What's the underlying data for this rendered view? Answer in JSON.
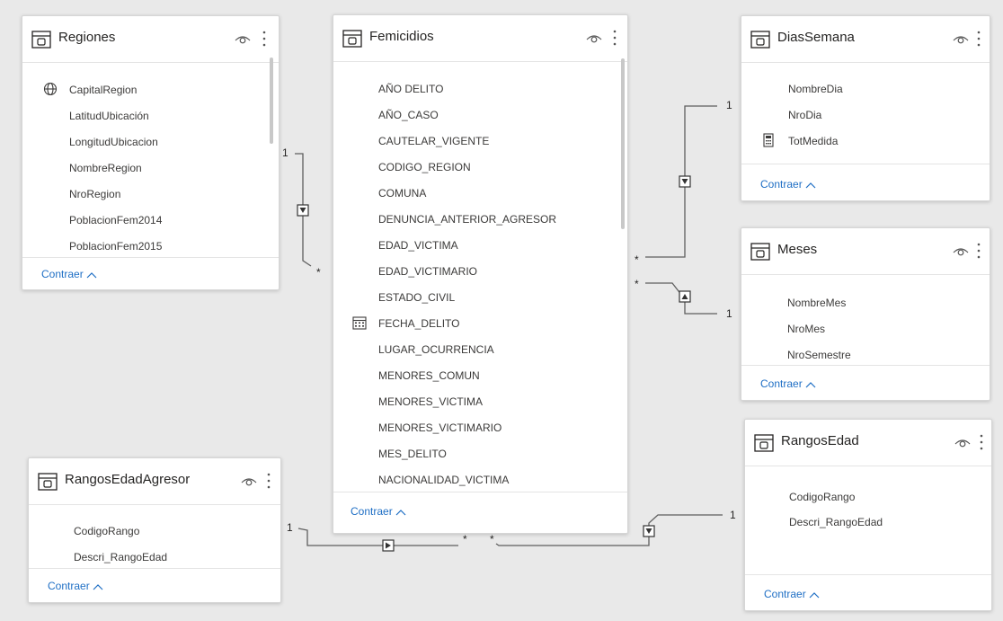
{
  "tables": {
    "regiones": {
      "title": "Regiones",
      "fields": [
        "CapitalRegion",
        "LatitudUbicación",
        "LongitudUbicacion",
        "NombreRegion",
        "NroRegion",
        "PoblacionFem2014",
        "PoblacionFem2015"
      ],
      "field_icons": [
        "globe-icon",
        "",
        "",
        "",
        "",
        "",
        ""
      ],
      "collapse_label": "Contraer"
    },
    "femicidios": {
      "title": "Femicidios",
      "fields": [
        "AÑO DELITO",
        "AÑO_CASO",
        "CAUTELAR_VIGENTE",
        "CODIGO_REGION",
        "COMUNA",
        "DENUNCIA_ANTERIOR_AGRESOR",
        "EDAD_VICTIMA",
        "EDAD_VICTIMARIO",
        "ESTADO_CIVIL",
        "FECHA_DELITO",
        "LUGAR_OCURRENCIA",
        "MENORES_COMUN",
        "MENORES_VICTIMA",
        "MENORES_VICTIMARIO",
        "MES_DELITO",
        "NACIONALIDAD_VICTIMA"
      ],
      "field_icons": [
        "",
        "",
        "",
        "",
        "",
        "",
        "",
        "",
        "",
        "calendar-icon",
        "",
        "",
        "",
        "",
        "",
        ""
      ],
      "collapse_label": "Contraer"
    },
    "diassemana": {
      "title": "DiasSemana",
      "fields": [
        "NombreDia",
        "NroDia",
        "TotMedida"
      ],
      "field_icons": [
        "",
        "",
        "calculator-icon"
      ],
      "collapse_label": "Contraer"
    },
    "meses": {
      "title": "Meses",
      "fields": [
        "NombreMes",
        "NroMes",
        "NroSemestre"
      ],
      "field_icons": [
        "",
        "",
        ""
      ],
      "collapse_label": "Contraer"
    },
    "rangosedad": {
      "title": "RangosEdad",
      "fields": [
        "CodigoRango",
        "Descri_RangoEdad"
      ],
      "field_icons": [
        "",
        ""
      ],
      "collapse_label": "Contraer"
    },
    "rangosedadagresor": {
      "title": "RangosEdadAgresor",
      "fields": [
        "CodigoRango",
        "Descri_RangoEdad"
      ],
      "field_icons": [
        "",
        ""
      ],
      "collapse_label": "Contraer"
    }
  },
  "relationships": [
    {
      "name": "regiones-femicidios",
      "one_label": "1",
      "many_label": "*",
      "direction": "down"
    },
    {
      "name": "diassemana-femicidios",
      "one_label": "1",
      "many_label": "*",
      "direction": "down"
    },
    {
      "name": "meses-femicidios",
      "one_label": "1",
      "many_label": "*",
      "direction": "up"
    },
    {
      "name": "rangosedadagresor-femicidios",
      "one_label": "1",
      "many_label": "*",
      "direction": "right"
    },
    {
      "name": "rangosedad-femicidios",
      "one_label": "1",
      "many_label": "*",
      "direction": "down"
    }
  ],
  "colors": {
    "accent": "#1f6fc5",
    "line": "#5f5f5f",
    "canvas": "#e9e9e9"
  }
}
